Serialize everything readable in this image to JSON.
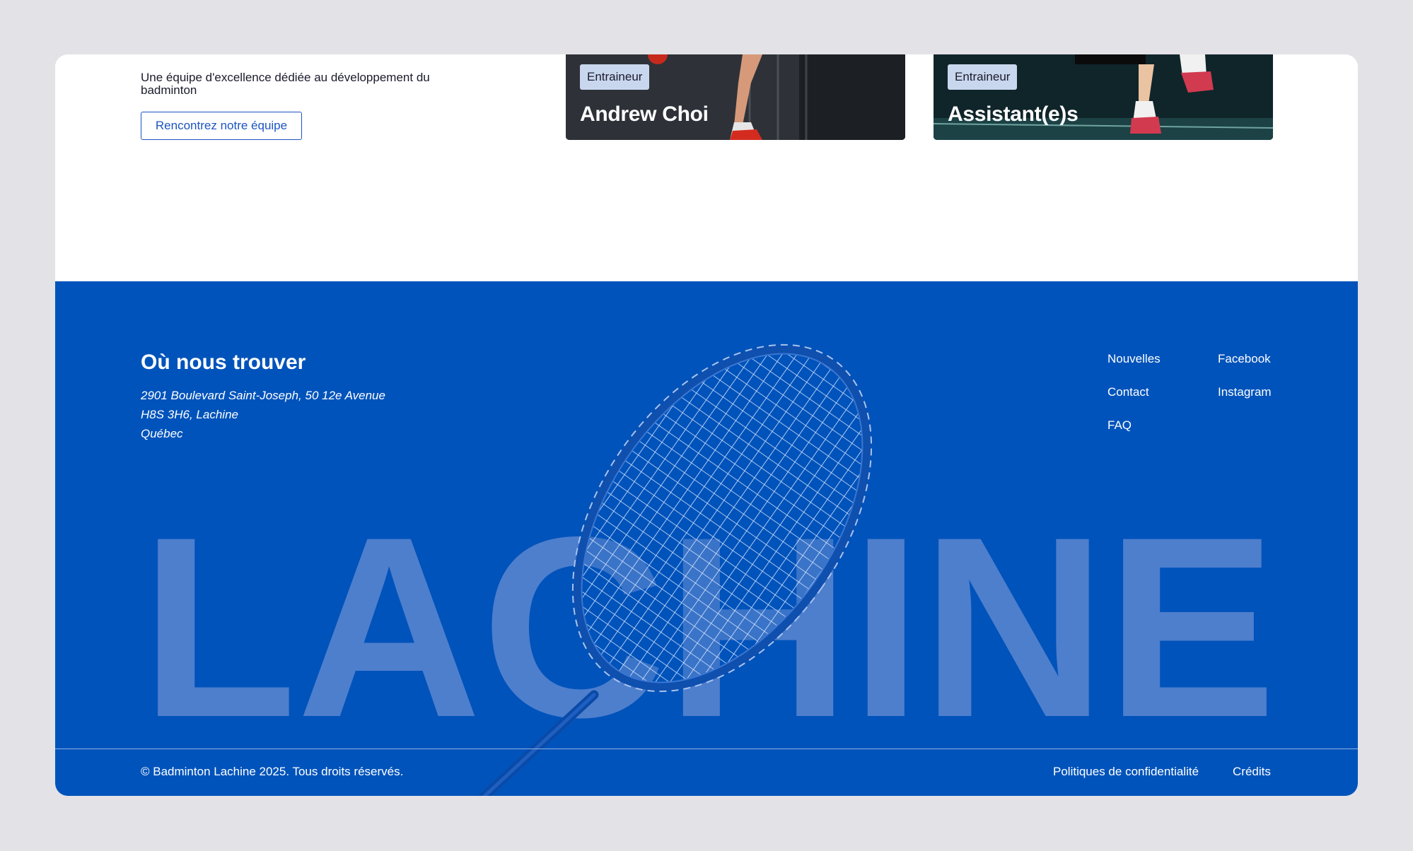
{
  "team": {
    "description": "Une équipe d'excellence dédiée au développement du badminton",
    "cta_label": "Rencontrez notre équipe",
    "cards": [
      {
        "tag": "Entraineur",
        "name": "Andrew Choi"
      },
      {
        "tag": "Entraineur",
        "name": "Assistant(e)s"
      }
    ]
  },
  "footer": {
    "location_title": "Où nous trouver",
    "address_lines": [
      "2901 Boulevard Saint-Joseph, 50 12e Avenue",
      "H8S 3H6, Lachine",
      "Québec"
    ],
    "links_col1": [
      "Nouvelles",
      "Contact",
      "FAQ"
    ],
    "links_col2": [
      "Facebook",
      "Instagram"
    ],
    "big_word": "LACHINE",
    "copyright": "© Badminton Lachine 2025. Tous droits réservés.",
    "legal_links": [
      "Politiques de confidentialité",
      "Crédits"
    ]
  },
  "colors": {
    "page_bg": "#e2e2e7",
    "footer_bg": "#0053bb",
    "big_word": "#4e7fcd",
    "button_accent": "#1b55c0",
    "tag_bg": "#c9d7ee"
  }
}
